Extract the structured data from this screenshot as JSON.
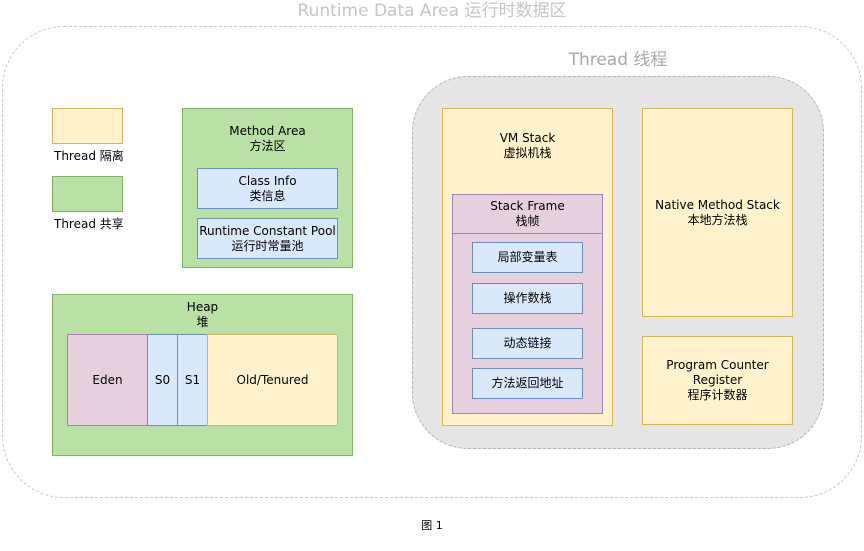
{
  "outer_title": "Runtime Data Area 运行时数据区",
  "thread_title": "Thread 线程",
  "legend": {
    "isolated": "Thread 隔离",
    "shared": "Thread 共享"
  },
  "method_area": {
    "title": "Method Area",
    "subtitle": "方法区",
    "class_info": {
      "title": "Class Info",
      "subtitle": "类信息"
    },
    "constant_pool": {
      "title": "Runtime Constant Pool",
      "subtitle": "运行时常量池"
    }
  },
  "heap": {
    "title": "Heap",
    "subtitle": "堆",
    "eden": "Eden",
    "s0": "S0",
    "s1": "S1",
    "old": "Old/Tenured"
  },
  "vm_stack": {
    "title": "VM Stack",
    "subtitle": "虚拟机栈",
    "frame": {
      "title": "Stack Frame",
      "subtitle": "栈帧",
      "items": [
        "局部变量表",
        "操作数栈",
        "动态链接",
        "方法返回地址"
      ]
    }
  },
  "native_stack": {
    "title": "Native Method Stack",
    "subtitle": "本地方法栈"
  },
  "pc_register": {
    "title": "Program Counter Register",
    "subtitle": "程序计数器"
  },
  "caption": "图 1",
  "colors": {
    "isolated_fill": "#fff2cc",
    "shared_fill": "#b9e0a5",
    "blue_fill": "#dae8fc",
    "pink_fill": "#e6d0de",
    "thread_bg": "#e5e5e5"
  }
}
